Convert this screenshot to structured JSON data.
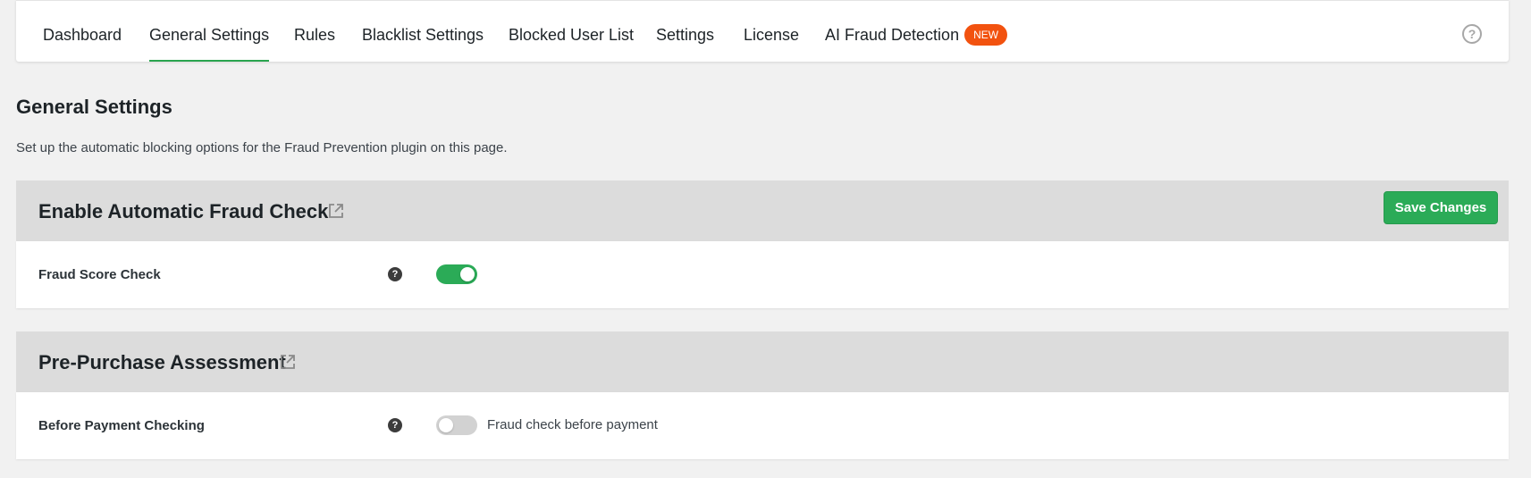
{
  "nav": {
    "tabs": [
      {
        "label": "Dashboard"
      },
      {
        "label": "General Settings"
      },
      {
        "label": "Rules"
      },
      {
        "label": "Blacklist Settings"
      },
      {
        "label": "Blocked User List"
      },
      {
        "label": "Settings"
      },
      {
        "label": "License"
      },
      {
        "label": "AI Fraud Detection",
        "badge": "NEW"
      }
    ],
    "active_tab": "General Settings",
    "help_icon": "question-circle-icon"
  },
  "page": {
    "title": "General Settings",
    "description": "Set up the automatic blocking options for the Fraud Prevention plugin on this page."
  },
  "sections": [
    {
      "title": "Enable Automatic Fraud Check",
      "save_label": "Save Changes",
      "settings": [
        {
          "label": "Fraud Score Check",
          "enabled": true,
          "description": ""
        }
      ]
    },
    {
      "title": "Pre-Purchase Assessment",
      "settings": [
        {
          "label": "Before Payment Checking",
          "enabled": false,
          "description": "Fraud check before payment"
        }
      ]
    }
  ],
  "colors": {
    "accent": "#2bab57",
    "badge": "#f2520f",
    "section_header": "#dcdcdc"
  }
}
